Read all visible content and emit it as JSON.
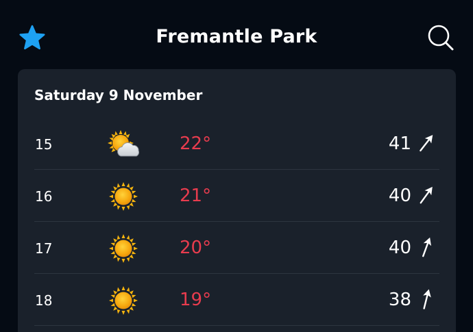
{
  "header": {
    "title": "Fremantle Park",
    "favourite_icon": "star-icon",
    "search_icon": "search-icon",
    "accent_color": "#1ea1f2"
  },
  "forecast": {
    "date": "Saturday 9 November",
    "temp_color": "#e83c4e",
    "rows": [
      {
        "hour": "15",
        "icon": "sun-behind-cloud-icon",
        "temp": "22°",
        "wind": "41",
        "wind_icon": "wind-direction-arrow-icon"
      },
      {
        "hour": "16",
        "icon": "sun-icon",
        "temp": "21°",
        "wind": "40",
        "wind_icon": "wind-direction-arrow-icon"
      },
      {
        "hour": "17",
        "icon": "sun-icon",
        "temp": "20°",
        "wind": "40",
        "wind_icon": "wind-direction-arrow-icon"
      },
      {
        "hour": "18",
        "icon": "sun-icon",
        "temp": "19°",
        "wind": "38",
        "wind_icon": "wind-direction-arrow-icon"
      }
    ]
  }
}
